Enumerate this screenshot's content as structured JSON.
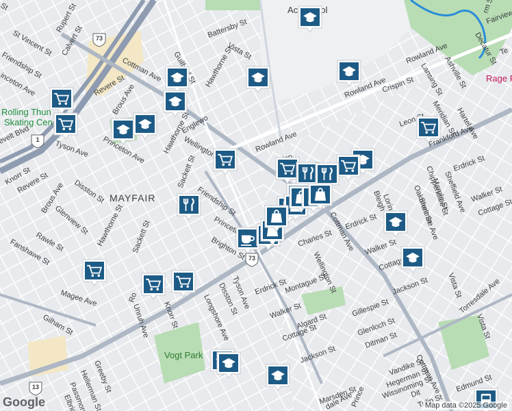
{
  "map": {
    "attribution": "Map data ©2025 Google",
    "logo": "Google",
    "colors": {
      "background": "#e8eaed",
      "street": "#ffffff",
      "arterial": "#aeb7c4",
      "highway": "#8e9bb0",
      "park": "#b8dcb4",
      "water": "#2a8cd8",
      "commercial": "#f3e7c5",
      "marker": "#1d5b86"
    }
  },
  "labels": {
    "neighborhood": "MAYFAIR",
    "vogt_park": "Vogt Park",
    "rolling1": "Rolling Thun",
    "rolling2": "Skating Cen",
    "school": "Ac      School",
    "rage": "Rage R",
    "streets": [
      {
        "id": "rowland-ave-1",
        "text": "Rowland Ave"
      },
      {
        "id": "rowland-ave-2",
        "text": "Rowland Ave"
      },
      {
        "id": "rowland-ave-3",
        "text": "Rowland Ave"
      },
      {
        "id": "frankford-ave",
        "text": "Frankford Ave"
      },
      {
        "id": "cottman-ave-1",
        "text": "Cottman Ave"
      },
      {
        "id": "cottman-ave-2",
        "text": "Cottman Ave"
      },
      {
        "id": "cottman-ave-3",
        "text": "Cottman Ave"
      },
      {
        "id": "tyson-ave-1",
        "text": "Tyson Ave"
      },
      {
        "id": "tyson-ave-2",
        "text": "Tyson Ave"
      },
      {
        "id": "magee-ave",
        "text": "Magee Ave"
      },
      {
        "id": "torresdale-ave",
        "text": "Torresdale Ave"
      },
      {
        "id": "brous-ave-1",
        "text": "Brous Ave"
      },
      {
        "id": "brous-ave-2",
        "text": "Brous Ave"
      },
      {
        "id": "sheffield-ave",
        "text": "Sheffield Ave"
      },
      {
        "id": "revere-st-1",
        "text": "Revere St"
      },
      {
        "id": "revere-st-2",
        "text": "Revere St"
      },
      {
        "id": "battersby-st",
        "text": "Battersby St"
      },
      {
        "id": "vista-st-1",
        "text": "Vista St"
      },
      {
        "id": "vista-st-2",
        "text": "Vista St"
      },
      {
        "id": "vista-st-3",
        "text": "Vista St"
      },
      {
        "id": "guilford-st",
        "text": "Guilford St"
      },
      {
        "id": "hawthorne-st-1",
        "text": "Hawthorne St"
      },
      {
        "id": "hawthorne-st-2",
        "text": "Hawthorne St"
      },
      {
        "id": "hawthorne-st-3",
        "text": "Hawthorne St"
      },
      {
        "id": "englewood",
        "text": "Englewo"
      },
      {
        "id": "wellington-st-1",
        "text": "Wellington St"
      },
      {
        "id": "wellington-st-2",
        "text": "Wellington St"
      },
      {
        "id": "sackett-st-1",
        "text": "Sackett St"
      },
      {
        "id": "sackett-st-2",
        "text": "Sackett St"
      },
      {
        "id": "friendship-st-1",
        "text": "Friendship St"
      },
      {
        "id": "friendship-st-2",
        "text": "Friendship St"
      },
      {
        "id": "princeton-ave-1",
        "text": "Princeton Ave"
      },
      {
        "id": "princeton-ave-2",
        "text": "Princeton Ave"
      },
      {
        "id": "princeton-ave-3",
        "text": "Princeto"
      },
      {
        "id": "brighton-st",
        "text": "Brighton St"
      },
      {
        "id": "disston-st-1",
        "text": "Disston St"
      },
      {
        "id": "disston-st-2",
        "text": "Disston St"
      },
      {
        "id": "longshore-ave",
        "text": "Longshore Ave"
      },
      {
        "id": "knorr-st-1",
        "text": "Knorr St"
      },
      {
        "id": "knorr-st-2",
        "text": "Knorr St"
      },
      {
        "id": "glenview-st",
        "text": "Glenview St"
      },
      {
        "id": "rawle-st",
        "text": "Rawle St"
      },
      {
        "id": "fanshawe-st",
        "text": "Fanshawe St"
      },
      {
        "id": "gilham-st",
        "text": "Gilham St"
      },
      {
        "id": "unruh-ave",
        "text": "Unruh Ave"
      },
      {
        "id": "greeby-st",
        "text": "Greeby St"
      },
      {
        "id": "hellerman-st",
        "text": "Hellerman St"
      },
      {
        "id": "passmore-st",
        "text": "Passmore St"
      },
      {
        "id": "elbridge-st",
        "text": "Elbridge St"
      },
      {
        "id": "st-vincent-st",
        "text": "St Vincent St"
      },
      {
        "id": "rupert-st",
        "text": "Rupert St"
      },
      {
        "id": "calvert-st",
        "text": "Calvert St"
      },
      {
        "id": "princeton-ave-w",
        "text": "inceton Ave"
      },
      {
        "id": "friendship-st-w",
        "text": "Friendship St"
      },
      {
        "id": "st-w",
        "text": "St"
      },
      {
        "id": "roosevelt-blvd",
        "text": "evelt Blvd"
      },
      {
        "id": "crispin-st-1",
        "text": "Crispin St"
      },
      {
        "id": "crispin-st-2",
        "text": "Crisp"
      },
      {
        "id": "leon-st",
        "text": "Leon St"
      },
      {
        "id": "lansing-st",
        "text": "Lansing St"
      },
      {
        "id": "ashville-st",
        "text": "Ashville St"
      },
      {
        "id": "decatur-st",
        "text": "Decatur St"
      },
      {
        "id": "hartel-ave",
        "text": "Hartel Ave"
      },
      {
        "id": "meridian-st",
        "text": "Meridian St"
      },
      {
        "id": "fairview",
        "text": "Fairview"
      },
      {
        "id": "tr",
        "text": "Te"
      },
      {
        "id": "chippendale-st",
        "text": "Chippendale St"
      },
      {
        "id": "marple-st",
        "text": "Marple St"
      },
      {
        "id": "oakmont-st",
        "text": "Oakmont St"
      },
      {
        "id": "shelmire-ave",
        "text": "Shelmire Ave"
      },
      {
        "id": "erdrick-st-1",
        "text": "Erdrick St"
      },
      {
        "id": "erdrick-st-2",
        "text": "Erdrick St"
      },
      {
        "id": "erdrick-st-3",
        "text": "Erdrick St"
      },
      {
        "id": "walker-st-1",
        "text": "Walker St"
      },
      {
        "id": "walker-st-2",
        "text": "Walker St"
      },
      {
        "id": "walker-st-3",
        "text": "Walker St"
      },
      {
        "id": "cottage-st-1",
        "text": "Cottage St"
      },
      {
        "id": "cottage-st-2",
        "text": "Cottage St"
      },
      {
        "id": "cottage-st-3",
        "text": "Cottage St"
      },
      {
        "id": "loring-st",
        "text": "Loring St"
      },
      {
        "id": "bleigh",
        "text": "Bleigh"
      },
      {
        "id": "jackson-st-1",
        "text": "Jackson St"
      },
      {
        "id": "jackson-st-2",
        "text": "Jackson St"
      },
      {
        "id": "charles-st",
        "text": "Charles St"
      },
      {
        "id": "wellington-st-3",
        "text": "Wellington St"
      },
      {
        "id": "montague-st",
        "text": "Montague St"
      },
      {
        "id": "algard-st",
        "text": "Algard St"
      },
      {
        "id": "gillespie-st",
        "text": "Gillespie St"
      },
      {
        "id": "glenloch-st",
        "text": "Glenloch St"
      },
      {
        "id": "ditman-st",
        "text": "Ditman St"
      },
      {
        "id": "marsden-st",
        "text": "Marsden St"
      },
      {
        "id": "vandike-st",
        "text": "Vandike St"
      },
      {
        "id": "hegerman-st",
        "text": "Hegerman St"
      },
      {
        "id": "wissinoming-st",
        "text": "Wissinoming St"
      },
      {
        "id": "tulip-st",
        "text": "Tulip St"
      },
      {
        "id": "edmund-st",
        "text": "Edmund St"
      },
      {
        "id": "prince",
        "text": "Prince"
      },
      {
        "id": "dale-ave",
        "text": "dale Ave"
      },
      {
        "id": "roosevelt-r",
        "text": "Ro"
      },
      {
        "id": "ditm",
        "text": "Dit"
      },
      {
        "id": "st-cot",
        "text": "St"
      },
      {
        "id": "rm-st",
        "text": "rm St"
      }
    ],
    "shields": [
      {
        "id": "shield-73-n",
        "text": "73"
      },
      {
        "id": "shield-1-w",
        "text": "1"
      },
      {
        "id": "shield-73-c",
        "text": "73"
      },
      {
        "id": "shield-13-sw",
        "text": "13"
      }
    ]
  },
  "markers": [
    {
      "type": "school",
      "icon": "graduation-cap-icon"
    },
    {
      "type": "school",
      "icon": "graduation-cap-icon"
    },
    {
      "type": "school",
      "icon": "graduation-cap-icon"
    },
    {
      "type": "school",
      "icon": "graduation-cap-icon"
    },
    {
      "type": "school",
      "icon": "graduation-cap-icon"
    },
    {
      "type": "school",
      "icon": "graduation-cap-icon"
    },
    {
      "type": "school",
      "icon": "graduation-cap-icon"
    },
    {
      "type": "school",
      "icon": "graduation-cap-icon"
    },
    {
      "type": "school",
      "icon": "graduation-cap-icon"
    },
    {
      "type": "school",
      "icon": "graduation-cap-icon"
    },
    {
      "type": "school",
      "icon": "graduation-cap-icon"
    },
    {
      "type": "school",
      "icon": "graduation-cap-icon"
    },
    {
      "type": "school",
      "icon": "graduation-cap-icon"
    },
    {
      "type": "grocery",
      "icon": "shopping-cart-icon"
    },
    {
      "type": "grocery",
      "icon": "shopping-cart-icon"
    },
    {
      "type": "grocery",
      "icon": "shopping-cart-icon"
    },
    {
      "type": "grocery",
      "icon": "shopping-cart-icon"
    },
    {
      "type": "grocery",
      "icon": "shopping-cart-icon"
    },
    {
      "type": "grocery",
      "icon": "shopping-cart-icon"
    },
    {
      "type": "grocery",
      "icon": "shopping-cart-icon"
    },
    {
      "type": "grocery",
      "icon": "shopping-cart-icon"
    },
    {
      "type": "grocery",
      "icon": "shopping-cart-icon"
    },
    {
      "type": "grocery",
      "icon": "shopping-cart-icon"
    },
    {
      "type": "restaurant",
      "icon": "fork-knife-icon"
    },
    {
      "type": "restaurant",
      "icon": "fork-knife-icon"
    },
    {
      "type": "restaurant",
      "icon": "fork-knife-icon"
    },
    {
      "type": "restaurant",
      "icon": "fork-knife-icon"
    },
    {
      "type": "restaurant",
      "icon": "fork-knife-icon"
    },
    {
      "type": "cafe",
      "icon": "coffee-cup-icon"
    },
    {
      "type": "shopping",
      "icon": "shopping-bag-icon"
    },
    {
      "type": "shopping",
      "icon": "shopping-bag-icon"
    },
    {
      "type": "shopping",
      "icon": "shopping-bag-icon"
    },
    {
      "type": "shopping",
      "icon": "shopping-bag-icon"
    },
    {
      "type": "shopping",
      "icon": "shopping-bag-icon"
    },
    {
      "type": "shopping",
      "icon": "shopping-bag-icon"
    },
    {
      "type": "shopping",
      "icon": "shopping-bag-icon"
    },
    {
      "type": "transit",
      "icon": "bus-icon"
    }
  ]
}
